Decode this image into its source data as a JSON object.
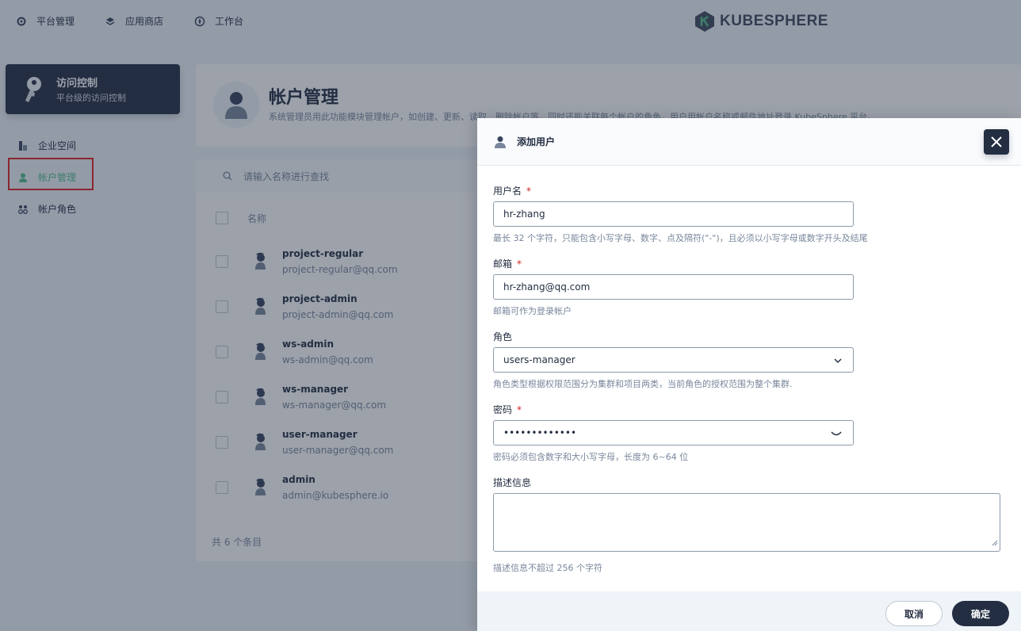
{
  "topnav": {
    "items": [
      {
        "label": "平台管理",
        "icon": "gear-icon"
      },
      {
        "label": "应用商店",
        "icon": "stack-icon"
      },
      {
        "label": "工作台",
        "icon": "compass-icon"
      }
    ],
    "logo": "KUBESPHERE"
  },
  "sidebar": {
    "header_title": "访问控制",
    "header_subtitle": "平台级的访问控制",
    "items": [
      {
        "label": "企业空间",
        "icon": "workspace-icon"
      },
      {
        "label": "帐户管理",
        "icon": "user-icon",
        "active": true
      },
      {
        "label": "帐户角色",
        "icon": "roles-icon"
      }
    ]
  },
  "banner": {
    "title": "帐户管理",
    "description": "系统管理员用此功能模块管理帐户，如创建、更新、读取、删除帐户等，同时还能关联每个帐户的角色，用户用帐户名称或邮件地址登录 KubeSphere 平台。"
  },
  "table": {
    "search_placeholder": "请输入名称进行查找",
    "column_name": "名称",
    "rows": [
      {
        "name": "project-regular",
        "email": "project-regular@qq.com"
      },
      {
        "name": "project-admin",
        "email": "project-admin@qq.com"
      },
      {
        "name": "ws-admin",
        "email": "ws-admin@qq.com"
      },
      {
        "name": "ws-manager",
        "email": "ws-manager@qq.com"
      },
      {
        "name": "user-manager",
        "email": "user-manager@qq.com"
      },
      {
        "name": "admin",
        "email": "admin@kubesphere.io"
      }
    ],
    "total": "共 6 个条目"
  },
  "modal": {
    "title": "添加用户",
    "username_label": "用户名",
    "username_value": "hr-zhang",
    "username_hint": "最长 32 个字符，只能包含小写字母、数字、点及隔符(\"-\")，且必须以小写字母或数字开头及结尾",
    "email_label": "邮箱",
    "email_value": "hr-zhang@qq.com",
    "email_hint": "邮箱可作为登录帐户",
    "role_label": "角色",
    "role_value": "users-manager",
    "role_hint": "角色类型根据权限范围分为集群和项目两类，当前角色的授权范围为整个集群.",
    "password_label": "密码",
    "password_value": "•••••••••••••",
    "password_hint": "密码必须包含数字和大小写字母，长度为 6~64 位",
    "desc_label": "描述信息",
    "desc_hint": "描述信息不超过 256 个字符",
    "required_mark": "*",
    "cancel": "取消",
    "ok": "确定"
  },
  "colors": {
    "primary": "#242e42",
    "accent": "#55bc8a",
    "required": "#ca2621",
    "highlight": "#e02020"
  }
}
